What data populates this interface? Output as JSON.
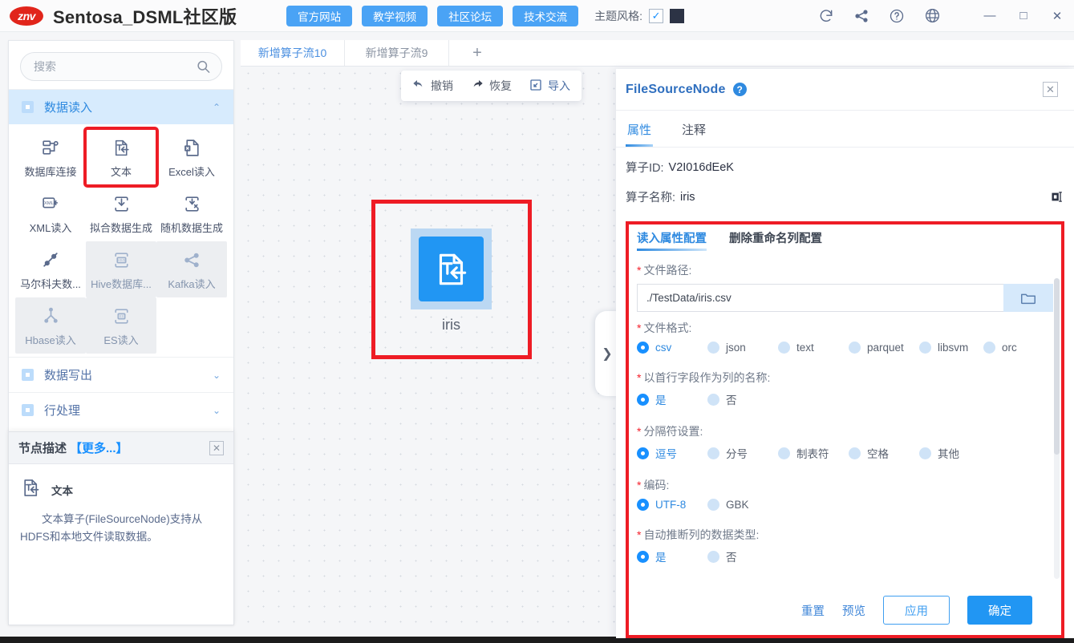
{
  "titlebar": {
    "logo_text": "znv",
    "app_title": "Sentosa_DSML社区版",
    "nav_buttons": [
      {
        "label": "官方网站",
        "name": "official-site-button"
      },
      {
        "label": "教学视频",
        "name": "tutorial-video-button"
      },
      {
        "label": "社区论坛",
        "name": "community-forum-button"
      },
      {
        "label": "技术交流",
        "name": "tech-exchange-button"
      }
    ],
    "theme_label": "主题风格:",
    "theme_checked": "✓",
    "theme_color": "#2c3345",
    "icons": [
      "refresh-icon",
      "share-nodes-icon",
      "help-icon",
      "language-globe-icon"
    ],
    "window_buttons": {
      "minimize": "—",
      "maximize": "□",
      "close": "✕"
    }
  },
  "sidebar": {
    "search": {
      "value": "",
      "placeholder": "搜索"
    },
    "categories": [
      {
        "label": "数据读入",
        "expanded": true
      },
      {
        "label": "数据写出",
        "expanded": false
      },
      {
        "label": "行处理",
        "expanded": false
      }
    ],
    "operators": [
      {
        "label": "数据库连接",
        "icon": "database-connect-icon",
        "disabled": false,
        "highlighted": false
      },
      {
        "label": "文本",
        "icon": "text-file-icon",
        "disabled": false,
        "highlighted": true
      },
      {
        "label": "Excel读入",
        "icon": "excel-file-icon",
        "disabled": false,
        "highlighted": false
      },
      {
        "label": "XML读入",
        "icon": "xml-file-icon",
        "disabled": false,
        "highlighted": false
      },
      {
        "label": "拟合数据生成",
        "icon": "fit-data-icon",
        "disabled": false,
        "highlighted": false
      },
      {
        "label": "随机数据生成",
        "icon": "random-data-icon",
        "disabled": false,
        "highlighted": false
      },
      {
        "label": "马尔科夫数...",
        "icon": "markov-data-icon",
        "disabled": false,
        "highlighted": false
      },
      {
        "label": "Hive数据库...",
        "icon": "hive-db-icon",
        "disabled": true,
        "highlighted": false
      },
      {
        "label": "Kafka读入",
        "icon": "kafka-icon",
        "disabled": true,
        "highlighted": false
      },
      {
        "label": "Hbase读入",
        "icon": "hbase-icon",
        "disabled": true,
        "highlighted": false
      },
      {
        "label": "ES读入",
        "icon": "elasticsearch-icon",
        "disabled": true,
        "highlighted": false
      }
    ]
  },
  "node_description": {
    "title": "节点描述",
    "more_label": "【更多...】",
    "close": "✕",
    "name": "文本",
    "text": "文本算子(FileSourceNode)支持从HDFS和本地文件读取数据。"
  },
  "tabs": [
    {
      "label": "新增算子流10",
      "active": true
    },
    {
      "label": "新增算子流9",
      "active": false
    }
  ],
  "tab_add": "+",
  "canvas_toolbar": [
    {
      "label": "撤销",
      "icon": "undo-icon"
    },
    {
      "label": "恢复",
      "icon": "redo-icon"
    },
    {
      "label": "导入",
      "icon": "import-icon"
    }
  ],
  "canvas_node": {
    "label": "iris",
    "icon": "text-file-node-icon"
  },
  "collapse_handle": "❯",
  "panel": {
    "title": "FileSourceNode",
    "help_badge": "?",
    "close": "✕",
    "tabs": [
      {
        "label": "属性",
        "active": true
      },
      {
        "label": "注释",
        "active": false
      }
    ],
    "operator_id_label": "算子ID:",
    "operator_id_value": "V2I016dEeK",
    "operator_name_label": "算子名称:",
    "operator_name_value": "iris",
    "config_tabs": [
      {
        "label": "读入属性配置",
        "active": true
      },
      {
        "label": "删除重命名列配置",
        "active": false
      }
    ],
    "fields": {
      "file_path": {
        "label": "文件路径:",
        "required": "*",
        "value": "./TestData/iris.csv",
        "browse_icon": "folder-icon"
      },
      "file_format": {
        "label": "文件格式:",
        "required": "*",
        "options": [
          "csv",
          "json",
          "text",
          "parquet",
          "libsvm",
          "orc"
        ],
        "selected": "csv"
      },
      "first_row_header": {
        "label": "以首行字段作为列的名称:",
        "required": "*",
        "options": [
          "是",
          "否"
        ],
        "selected": "是"
      },
      "delimiter": {
        "label": "分隔符设置:",
        "required": "*",
        "options": [
          "逗号",
          "分号",
          "制表符",
          "空格",
          "其他"
        ],
        "selected": "逗号"
      },
      "encoding": {
        "label": "编码:",
        "required": "*",
        "options": [
          "UTF-8",
          "GBK"
        ],
        "selected": "UTF-8"
      },
      "infer_schema": {
        "label": "自动推断列的数据类型:",
        "required": "*",
        "options": [
          "是",
          "否"
        ],
        "selected": "是"
      }
    },
    "footer": {
      "reset": "重置",
      "preview": "预览",
      "apply": "应用",
      "confirm": "确定"
    }
  },
  "colors": {
    "accent": "#2196f3",
    "highlight_red": "#ee1c25",
    "brand_red": "#e1251b",
    "link_blue": "#2f8ae0"
  }
}
